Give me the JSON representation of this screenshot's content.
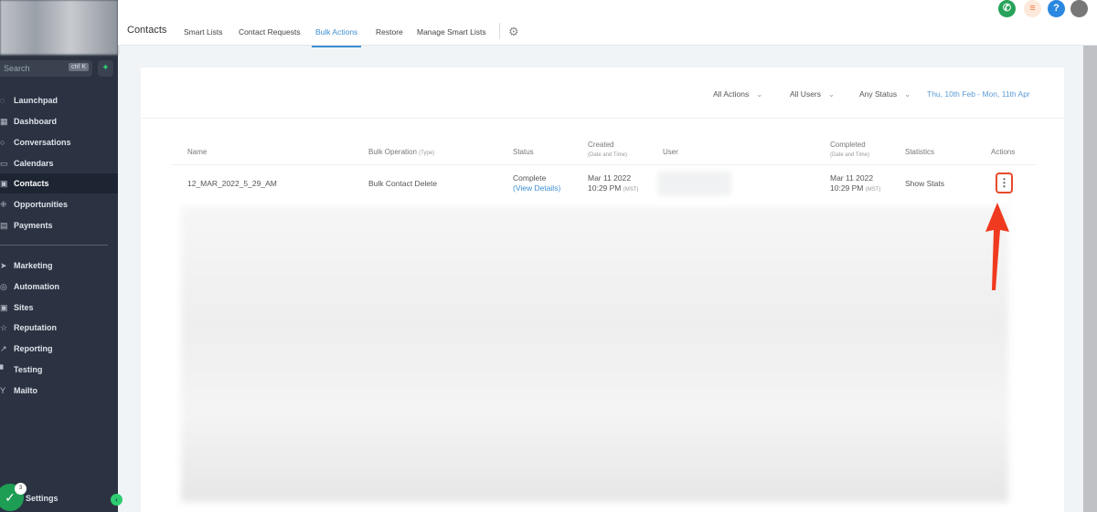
{
  "sidebar": {
    "search_placeholder": "Search",
    "search_shortcut": "ctrl K",
    "items": [
      {
        "label": "Launchpad",
        "icon": "◌"
      },
      {
        "label": "Dashboard",
        "icon": "▦"
      },
      {
        "label": "Conversations",
        "icon": "○"
      },
      {
        "label": "Calendars",
        "icon": "▭"
      },
      {
        "label": "Contacts",
        "icon": "▣"
      },
      {
        "label": "Opportunities",
        "icon": "⁜"
      },
      {
        "label": "Payments",
        "icon": "▤"
      },
      {
        "label": "Marketing",
        "icon": "➤"
      },
      {
        "label": "Automation",
        "icon": "◎"
      },
      {
        "label": "Sites",
        "icon": "▣"
      },
      {
        "label": "Reputation",
        "icon": "☆"
      },
      {
        "label": "Reporting",
        "icon": "↗"
      },
      {
        "label": "Testing",
        "icon": "▘"
      },
      {
        "label": "Mailto",
        "icon": "Y"
      }
    ],
    "settings_label": "Settings",
    "notification_count": "3"
  },
  "header": {
    "title": "Contacts",
    "tabs": [
      "Smart Lists",
      "Contact Requests",
      "Bulk Actions",
      "Restore",
      "Manage Smart Lists"
    ],
    "active_tab": "Bulk Actions"
  },
  "filters": {
    "actions": "All Actions",
    "users": "All Users",
    "status": "Any Status",
    "date_range": "Thu, 10th Feb - Mon, 11th Apr"
  },
  "table": {
    "headers": {
      "name": "Name",
      "operation": "Bulk Operation",
      "operation_sub": "(Type)",
      "status": "Status",
      "created": "Created",
      "created_sub": "(Date and Time)",
      "user": "User",
      "completed": "Completed",
      "completed_sub": "(Date and Time)",
      "statistics": "Statistics",
      "actions": "Actions"
    },
    "rows": [
      {
        "name": "12_MAR_2022_5_29_AM",
        "operation": "Bulk Contact Delete",
        "status": "Complete",
        "status_link": "(View Details)",
        "created_date": "Mar 11 2022",
        "created_time": "10:29 PM",
        "created_tz": "(MST)",
        "completed_date": "Mar 11 2022",
        "completed_time": "10:29 PM",
        "completed_tz": "(MST)",
        "statistics": "Show Stats"
      }
    ]
  },
  "colors": {
    "accent": "#3d8fd1",
    "sidebar": "#2b3342",
    "highlight": "#e84a2b"
  }
}
